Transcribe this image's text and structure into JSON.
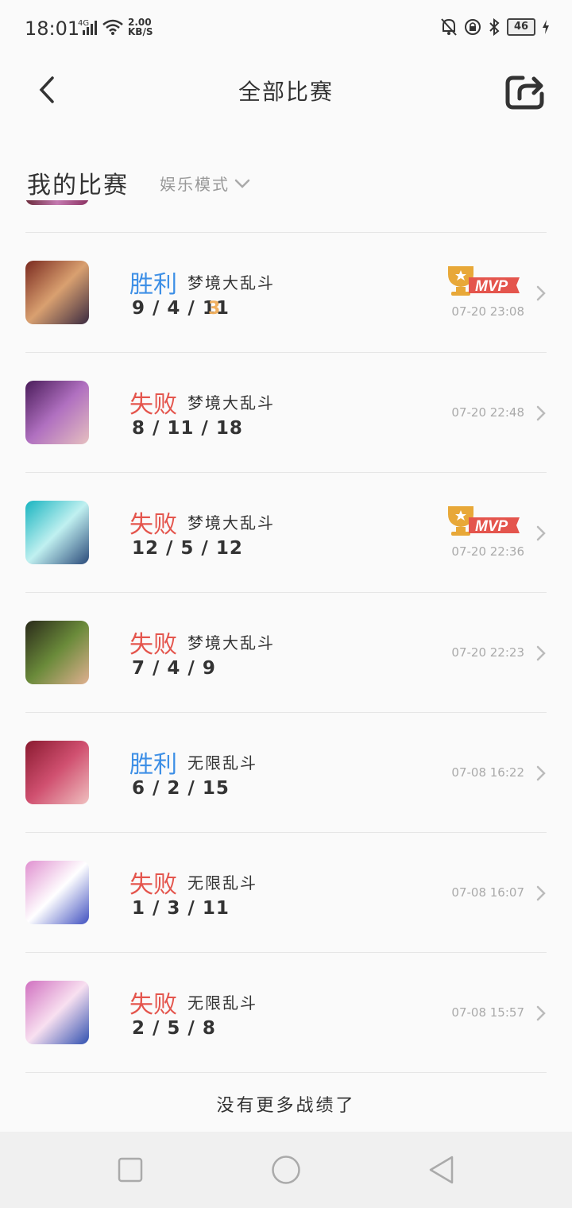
{
  "status": {
    "time": "18:01",
    "network": "4G",
    "speed_value": "2.00",
    "speed_unit": "KB/S",
    "battery": "46"
  },
  "header": {
    "title": "全部比赛"
  },
  "section": {
    "title": "我的比赛",
    "mode": "娱乐模式"
  },
  "matches": [
    {
      "result": "胜利",
      "result_color": "#3d8fe6",
      "name": "梦境大乱斗",
      "kda": "9 / 4 / 11",
      "rank": "3",
      "mvp": true,
      "date": "07-20 23:08",
      "avatar_colors": [
        "#7a2a20",
        "#d9a070",
        "#3a2a40"
      ]
    },
    {
      "result": "失败",
      "result_color": "#e4554d",
      "name": "梦境大乱斗",
      "kda": "8 / 11 / 18",
      "rank": "",
      "mvp": false,
      "date": "07-20 22:48",
      "avatar_colors": [
        "#4a1c5a",
        "#b070c0",
        "#e6c0c0"
      ]
    },
    {
      "result": "失败",
      "result_color": "#e4554d",
      "name": "梦境大乱斗",
      "kda": "12 / 5 / 12",
      "rank": "",
      "mvp": true,
      "date": "07-20 22:36",
      "avatar_colors": [
        "#18b4c0",
        "#c0f0f0",
        "#2a4a7a"
      ]
    },
    {
      "result": "失败",
      "result_color": "#e4554d",
      "name": "梦境大乱斗",
      "kda": "7 / 4 / 9",
      "rank": "",
      "mvp": false,
      "date": "07-20 22:23",
      "avatar_colors": [
        "#2a2a1a",
        "#6a8a3a",
        "#e0b090"
      ]
    },
    {
      "result": "胜利",
      "result_color": "#3d8fe6",
      "name": "无限乱斗",
      "kda": "6 / 2 / 15",
      "rank": "",
      "mvp": false,
      "date": "07-08 16:22",
      "avatar_colors": [
        "#8a1a30",
        "#d05070",
        "#f0c0c0"
      ]
    },
    {
      "result": "失败",
      "result_color": "#e4554d",
      "name": "无限乱斗",
      "kda": "1 / 3 / 11",
      "rank": "",
      "mvp": false,
      "date": "07-08 16:07",
      "avatar_colors": [
        "#e090d0",
        "#ffffff",
        "#4050c0"
      ]
    },
    {
      "result": "失败",
      "result_color": "#e4554d",
      "name": "无限乱斗",
      "kda": "2 / 5 / 8",
      "rank": "",
      "mvp": false,
      "date": "07-08 15:57",
      "avatar_colors": [
        "#d070c0",
        "#f8e0f0",
        "#3050b0"
      ]
    }
  ],
  "footer": {
    "text": "没有更多战绩了"
  },
  "icons": {
    "back": "chevron-left-icon",
    "share": "share-icon",
    "mvp": "trophy-mvp-icon"
  }
}
